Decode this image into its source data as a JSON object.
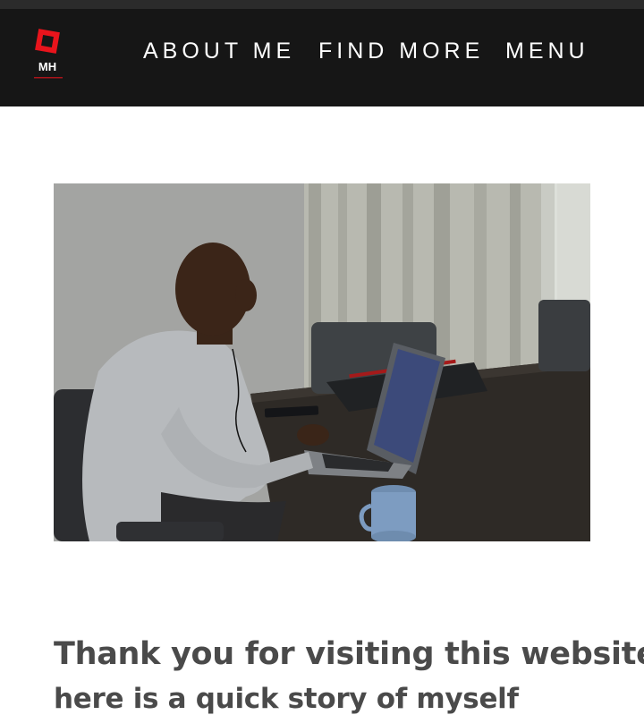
{
  "header": {
    "logo": {
      "text": "MH",
      "icon": "red-square-logo-icon",
      "accent_color": "#e8141c"
    },
    "nav": [
      {
        "label": "ABOUT ME"
      },
      {
        "label": "FIND MORE"
      },
      {
        "label": "MENU"
      }
    ],
    "background_color": "#161616"
  },
  "hero_image": {
    "subject": "man-working-at-laptop-photo"
  },
  "content": {
    "headline": "Thank you for visiting this website",
    "subheadline": "here is a quick story of myself",
    "text_color": "#4a4a4a"
  }
}
